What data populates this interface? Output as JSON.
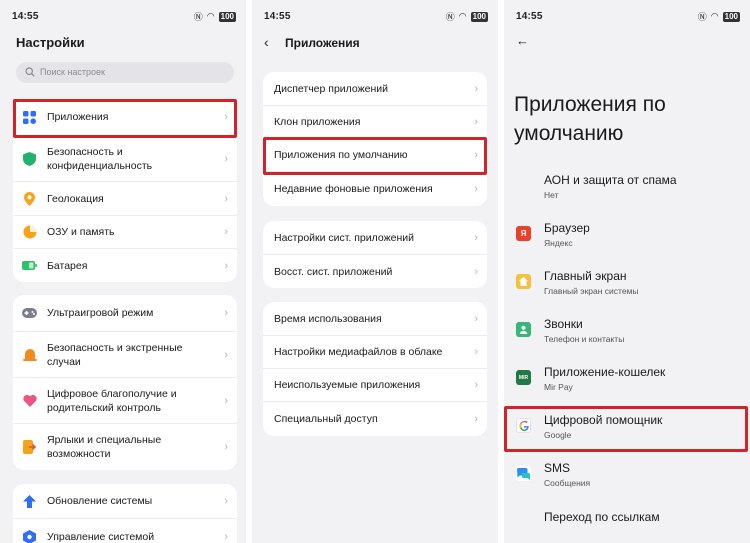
{
  "status": {
    "time": "14:55",
    "battery": "100"
  },
  "panel1": {
    "title": "Настройки",
    "search_placeholder": "Поиск настроек",
    "group1": [
      "Приложения",
      "Безопасность и конфиденциальность",
      "Геолокация",
      "ОЗУ и память",
      "Батарея"
    ],
    "group2": [
      "Ультраигровой режим",
      "Безопасность и экстренные случаи",
      "Цифровое благополучие и родительский контроль",
      "Ярлыки и специальные возможности"
    ],
    "group3": [
      "Обновление системы",
      "Управление системой"
    ]
  },
  "panel2": {
    "title": "Приложения",
    "group1": [
      "Диспетчер приложений",
      "Клон приложения",
      "Приложения по умолчанию",
      "Недавние фоновые приложения"
    ],
    "group2": [
      "Настройки сист. приложений",
      "Восст. сист. приложений"
    ],
    "group3": [
      "Время использования",
      "Настройки медиафайлов в облаке",
      "Неиспользуемые приложения",
      "Специальный доступ"
    ]
  },
  "panel3": {
    "title": "Приложения по умолчанию",
    "items": [
      {
        "title": "АОН и защита от спама",
        "subtitle": "Нет"
      },
      {
        "title": "Браузер",
        "subtitle": "Яндекс",
        "icon": "yandex-icon"
      },
      {
        "title": "Главный экран",
        "subtitle": "Главный экран системы",
        "icon": "home-icon"
      },
      {
        "title": "Звонки",
        "subtitle": "Телефон и контакты",
        "icon": "contacts-icon"
      },
      {
        "title": "Приложение-кошелек",
        "subtitle": "Mir Pay",
        "icon": "mirpay-icon"
      },
      {
        "title": "Цифровой помощник",
        "subtitle": "Google",
        "icon": "google-icon"
      },
      {
        "title": "SMS",
        "subtitle": "Сообщения",
        "icon": "messages-icon"
      },
      {
        "title": "Переход по ссылкам"
      }
    ]
  },
  "icon_glyphs": {
    "yandex": "Я",
    "mirpay": "MIR"
  },
  "colors": {
    "highlight": "#d2232a",
    "background": "#f2f2f4"
  }
}
